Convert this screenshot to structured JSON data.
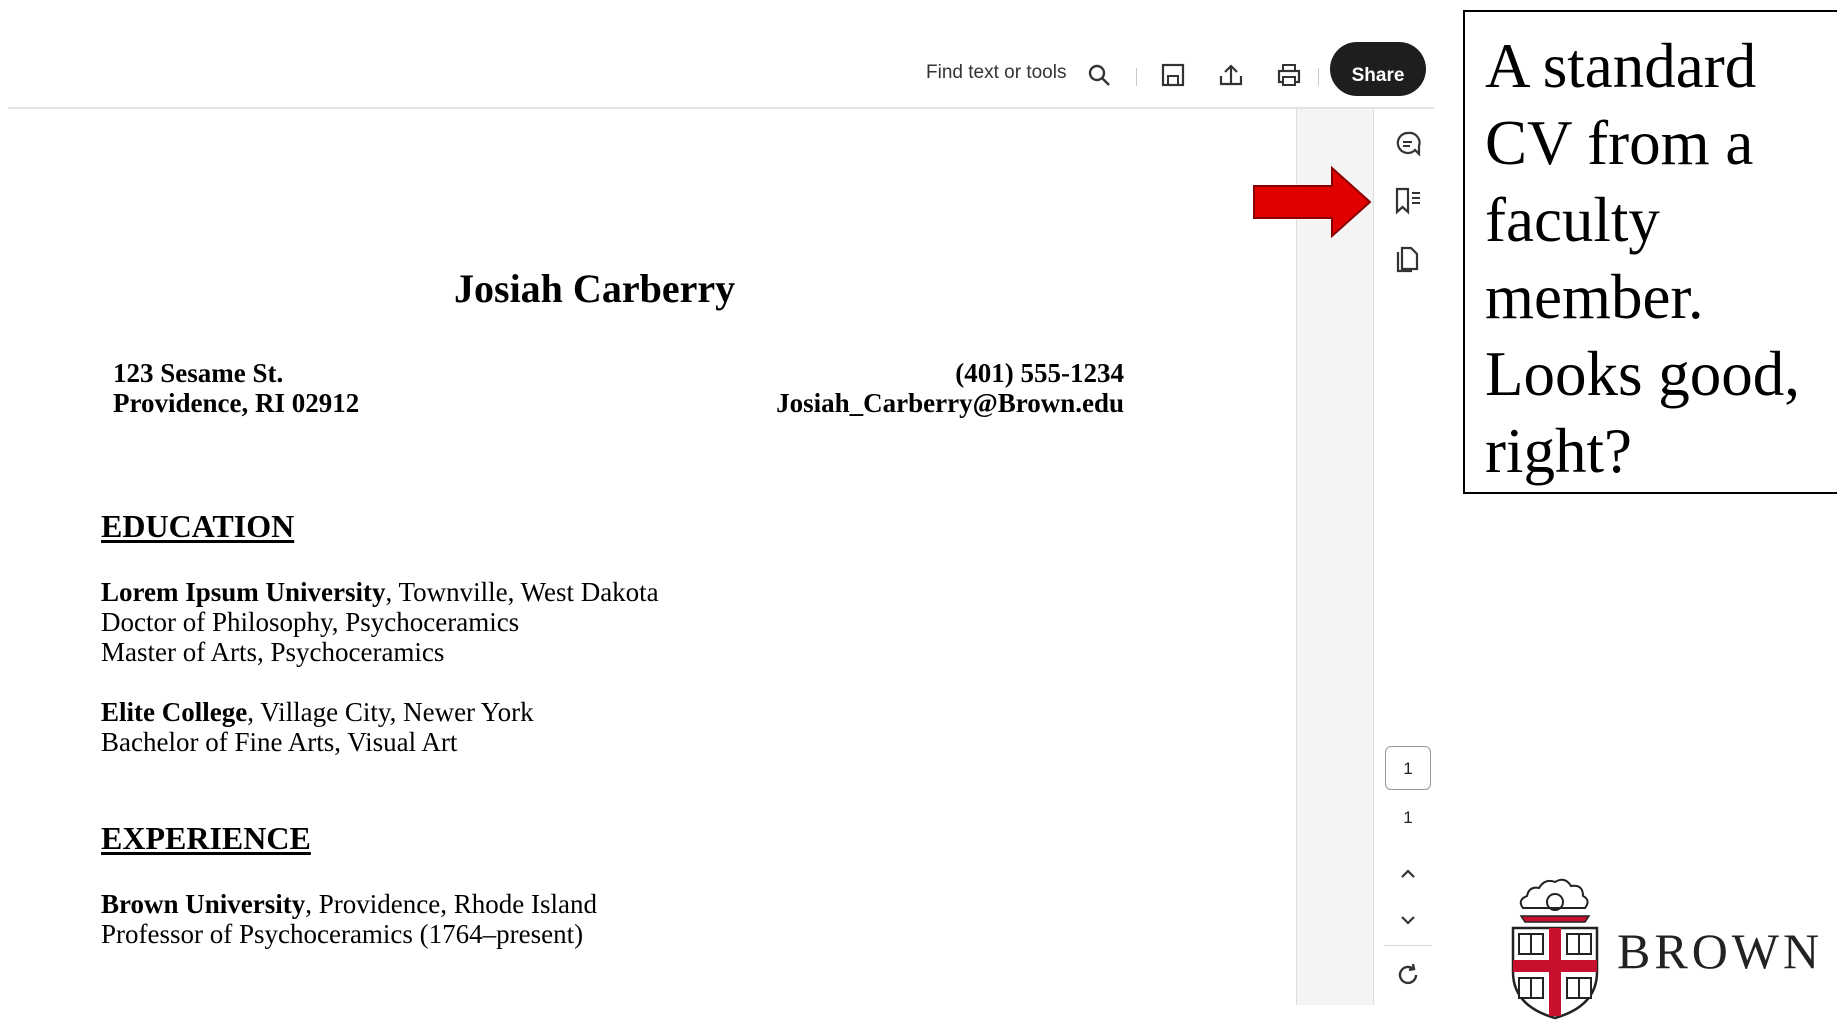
{
  "toolbar": {
    "find_placeholder": "Find text or tools",
    "share_label": "Share",
    "icons": [
      "search-icon",
      "save-icon",
      "upload-icon",
      "print-icon"
    ]
  },
  "rail": {
    "icons": [
      "comment-icon",
      "bookmark-list-icon",
      "copy-pages-icon",
      "chevron-up-icon",
      "chevron-down-icon",
      "refresh-icon"
    ],
    "page_input": "1",
    "page_total": "1"
  },
  "cv": {
    "name": "Josiah Carberry",
    "address_line1": "123 Sesame St.",
    "address_line2": "Providence, RI 02912",
    "phone": "(401) 555-1234",
    "email": "Josiah_Carberry@Brown.edu",
    "education_heading": "EDUCATION",
    "education": [
      {
        "institution": "Lorem Ipsum University",
        "location": ", Townville, West Dakota",
        "degrees": [
          "Doctor of Philosophy, Psychoceramics",
          "Master of Arts, Psychoceramics"
        ]
      },
      {
        "institution": "Elite College",
        "location": ", Village City, Newer York",
        "degrees": [
          "Bachelor of Fine Arts, Visual Art"
        ]
      }
    ],
    "experience_heading": "EXPERIENCE",
    "experience": [
      {
        "institution": "Brown University",
        "location": ", Providence, Rhode Island",
        "roles": [
          "Professor of Psychoceramics (1764–present)"
        ]
      }
    ]
  },
  "annotation": {
    "text": "A standard CV from a faculty member. Looks good, right?",
    "lines": [
      "A standard",
      "CV from a",
      "faculty",
      "member.",
      "Looks good,",
      "right?"
    ]
  },
  "logo": {
    "wordmark": "BROWN"
  },
  "colors": {
    "arrow": "#e00000",
    "share_button": "#1e1e1e",
    "logo_red": "#c8102e"
  }
}
